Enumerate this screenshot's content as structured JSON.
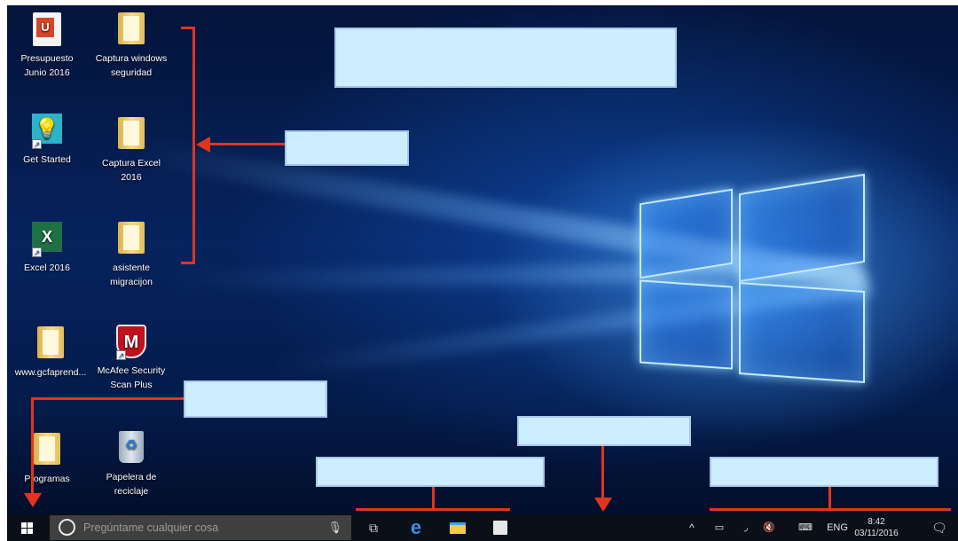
{
  "desktop": {
    "icons": [
      {
        "label": "Presupuesto\nJunio 2016",
        "icon": "pdf-document-icon"
      },
      {
        "label": "Captura windows\nseguridad",
        "icon": "folder-icon"
      },
      {
        "label": "Get Started",
        "icon": "get-started-lightbulb-icon"
      },
      {
        "label": "Captura Excel\n2016",
        "icon": "folder-icon"
      },
      {
        "label": "Excel 2016",
        "icon": "excel-icon"
      },
      {
        "label": "asistente\nmigracijon",
        "icon": "folder-icon"
      },
      {
        "label": "www.gcfaprend...",
        "icon": "folder-icon"
      },
      {
        "label": "McAfee Security\nScan Plus",
        "icon": "mcafee-shield-icon"
      },
      {
        "label": "Programas",
        "icon": "folder-icon"
      },
      {
        "label": "Papelera de\nreciclaje",
        "icon": "recycle-bin-icon"
      }
    ]
  },
  "taskbar": {
    "search_placeholder": "Pregúntame cualquier cosa",
    "pinned": [
      "task-view-icon",
      "edge-icon",
      "file-explorer-icon",
      "store-icon"
    ],
    "tray": {
      "language": "ENG",
      "time": "8:42",
      "date": "03/11/2016"
    }
  },
  "colors": {
    "annotation_line": "#e1341f",
    "callout_fill": "#cdeeff",
    "taskbar_bg": "#0b0f17"
  }
}
